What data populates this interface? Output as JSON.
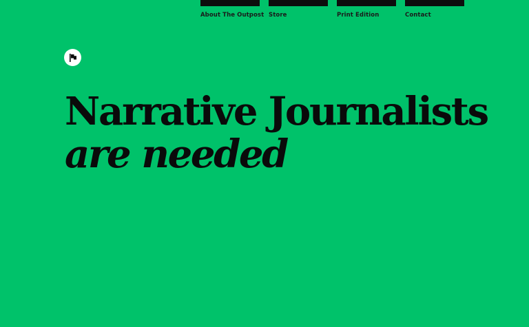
{
  "nav": {
    "items": [
      {
        "label": "About The Outpost"
      },
      {
        "label": "Store"
      },
      {
        "label": "Print Edition"
      },
      {
        "label": "Contact"
      }
    ]
  },
  "logo": {
    "icon": "flag-icon",
    "background": "#ffffff"
  },
  "headline": {
    "line1": "Narrative Journalists",
    "line2": "are needed"
  },
  "colors": {
    "background": "#00c26a",
    "text": "#0a0a0a",
    "nav_bar": "#0d0d0d"
  }
}
